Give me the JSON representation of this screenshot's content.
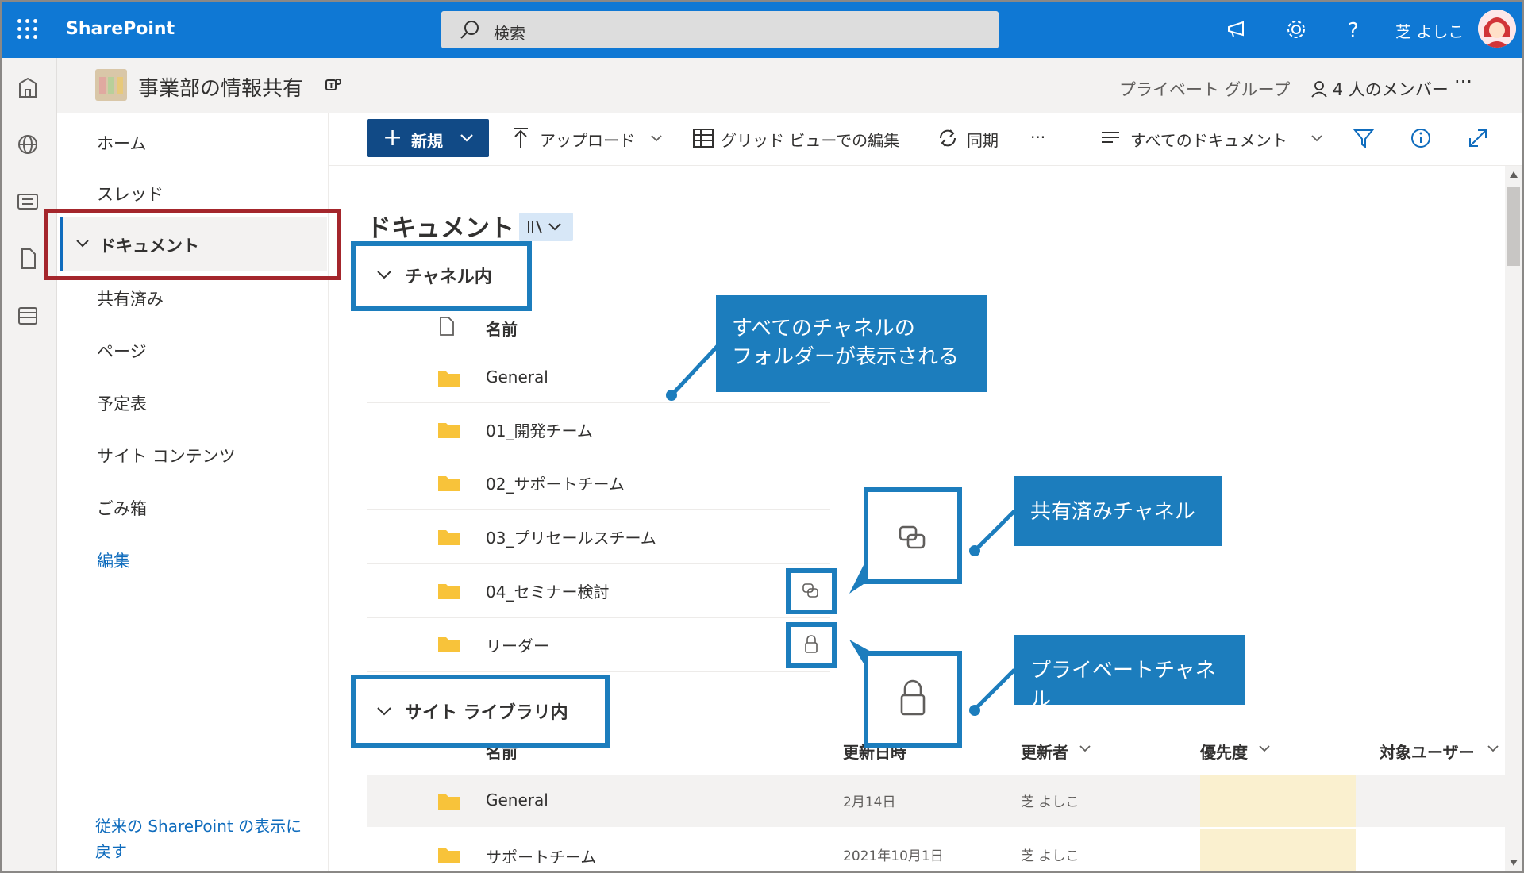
{
  "suite_bar": {
    "brand": "SharePoint",
    "search_placeholder": "検索",
    "user_name": "芝 よしこ"
  },
  "site": {
    "title": "事業部の情報共有",
    "privacy": "プライベート グループ",
    "members": "4 人のメンバー",
    "more": "···"
  },
  "nav": {
    "items": [
      {
        "label": "ホーム"
      },
      {
        "label": "スレッド"
      },
      {
        "label": "ドキュメント"
      },
      {
        "label": "共有済み"
      },
      {
        "label": "ページ"
      },
      {
        "label": "予定表"
      },
      {
        "label": "サイト コンテンツ"
      },
      {
        "label": "ごみ箱"
      },
      {
        "label": "編集"
      }
    ],
    "classic_link": "従来の SharePoint の表示に戻す"
  },
  "command_bar": {
    "new_label": "新規",
    "upload_label": "アップロード",
    "grid_edit_label": "グリッド ビューでの編集",
    "sync_label": "同期",
    "more_label": "···",
    "view_label": "すべてのドキュメント"
  },
  "library": {
    "title": "ドキュメント",
    "channel_group": {
      "label": "チャネル内",
      "name_header": "名前",
      "rows": [
        {
          "name": "General"
        },
        {
          "name": "01_開発チーム"
        },
        {
          "name": "02_サポートチーム"
        },
        {
          "name": "03_プリセールスチーム"
        },
        {
          "name": "04_セミナー検討"
        },
        {
          "name": "リーダー"
        }
      ]
    },
    "site_group": {
      "label": "サイト ライブラリ内",
      "headers": {
        "name": "名前",
        "modified": "更新日時",
        "modified_by": "更新者",
        "priority": "優先度",
        "audience": "対象ユーザー"
      },
      "rows": [
        {
          "name": "General",
          "modified": "2月14日",
          "modified_by": "芝 よしこ"
        },
        {
          "name": "サポートチーム",
          "modified": "2021年10月1日",
          "modified_by": "芝 よしこ"
        }
      ]
    }
  },
  "annotations": {
    "all_channels": "すべてのチャネルのフォルダーが表示される",
    "all_channels_line1": "すべてのチャネルの",
    "all_channels_line2": "フォルダーが表示される",
    "shared_channel": "共有済みチャネル",
    "private_channel": "プライベートチャネル"
  },
  "colors": {
    "suite_bar": "#0f78d4",
    "new_button": "#114a86",
    "annotation_blue": "#1c7dbd",
    "annotation_red": "#a4262c",
    "folder": "#f8c33a",
    "priority_cell": "#faf0cf"
  }
}
